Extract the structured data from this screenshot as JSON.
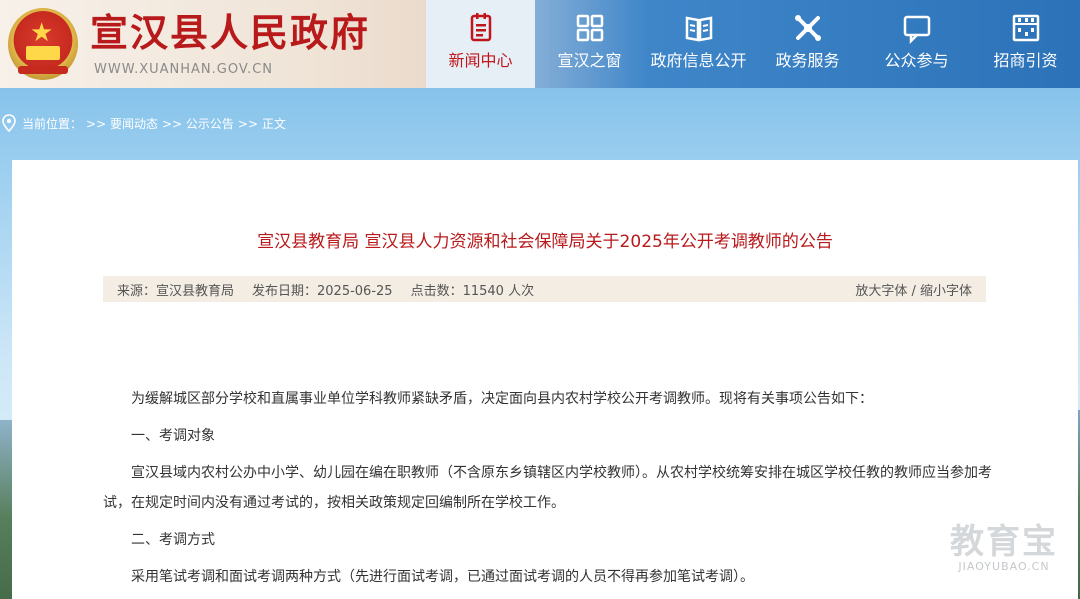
{
  "header": {
    "site_title": "宣汉县人民政府",
    "site_url": "WWW.XUANHAN.GOV.CN"
  },
  "nav": {
    "items": [
      {
        "label": "新闻中心",
        "icon": "newspaper-icon",
        "active": true
      },
      {
        "label": "宣汉之窗",
        "icon": "grid-icon",
        "active": false
      },
      {
        "label": "政府信息公开",
        "icon": "book-icon",
        "active": false
      },
      {
        "label": "政务服务",
        "icon": "service-icon",
        "active": false
      },
      {
        "label": "公众参与",
        "icon": "chat-icon",
        "active": false
      },
      {
        "label": "招商引资",
        "icon": "abacus-icon",
        "active": false
      }
    ]
  },
  "breadcrumb": {
    "prefix": "当前位置：",
    "items": [
      ">> 要闻动态",
      ">> 公示公告",
      ">> 正文"
    ]
  },
  "article": {
    "title": "宣汉县教育局 宣汉县人力资源和社会保障局关于2025年公开考调教师的公告",
    "meta": {
      "source": "来源：宣汉县教育局",
      "date": "发布日期：2025-06-25",
      "clicks": "点击数：11540 人次",
      "enlarge": "放大字体",
      "separator": " / ",
      "shrink": "缩小字体"
    },
    "paragraphs": [
      "为缓解城区部分学校和直属事业单位学科教师紧缺矛盾，决定面向县内农村学校公开考调教师。现将有关事项公告如下：",
      "一、考调对象",
      "宣汉县域内农村公办中小学、幼儿园在编在职教师（不含原东乡镇辖区内学校教师）。从农村学校统筹安排在城区学校任教的教师应当参加考试，在规定时间内没有通过考试的，按相关政策规定回编制所在学校工作。",
      "二、考调方式",
      "采用笔试考调和面试考调两种方式（先进行面试考调，已通过面试考调的人员不得再参加笔试考调）。"
    ]
  },
  "watermark": {
    "brand": "教育宝",
    "domain": "JIAOYUBAO.CN"
  },
  "colors": {
    "brand_red": "#b8191b",
    "nav_blue": "#2b72b8",
    "meta_bg": "#f3ede3"
  }
}
